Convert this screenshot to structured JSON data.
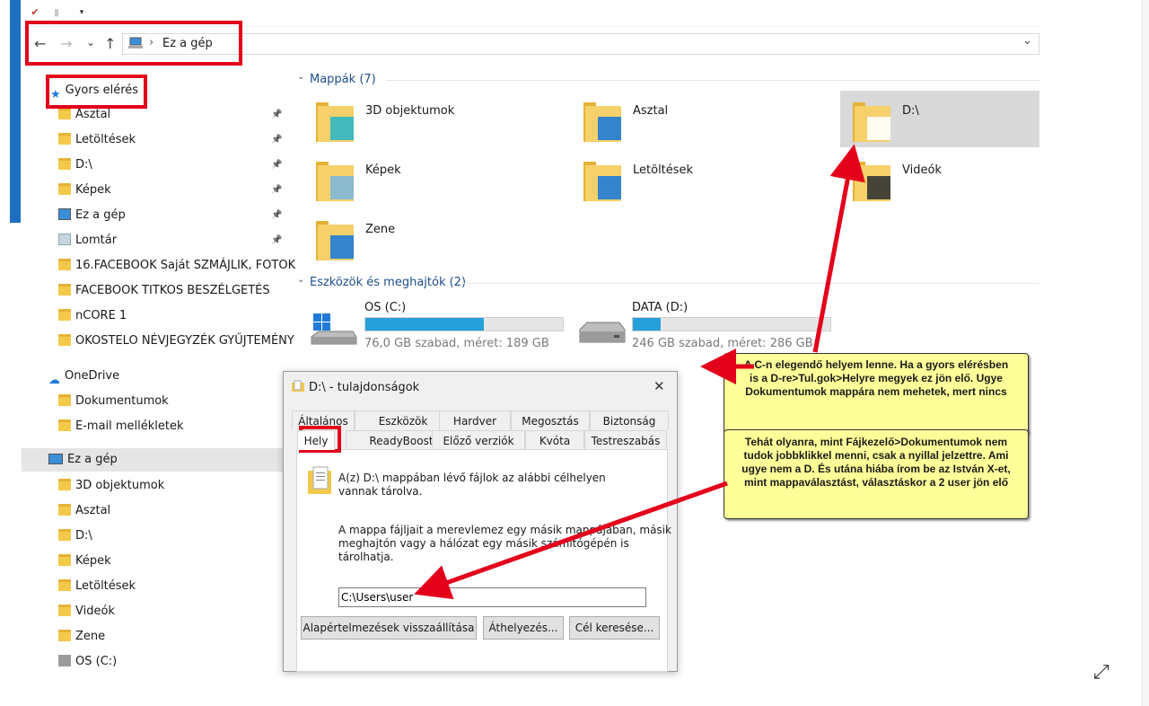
{
  "address": {
    "path_label": "Ez a gép",
    "separator": "›",
    "back": "←",
    "forward": "→",
    "recent": "⌄",
    "up": "↑",
    "dropdown": "⌄"
  },
  "sidebar": {
    "quick_access": "Gyors elérés",
    "quick_items": [
      {
        "label": "Asztal",
        "pinned": true
      },
      {
        "label": "Letöltések",
        "pinned": true
      },
      {
        "label": "D:\\",
        "pinned": true
      },
      {
        "label": "Képek",
        "pinned": true
      },
      {
        "label": "Ez a gép",
        "pinned": true
      },
      {
        "label": "Lomtár",
        "pinned": true
      },
      {
        "label": "16.FACEBOOK Saját SZMÁJLIK, FOTOK"
      },
      {
        "label": "FACEBOOK TITKOS BESZÉLGETÉS"
      },
      {
        "label": "nCORE 1"
      },
      {
        "label": "OKOSTELO NÉVJEGYZÉK GYŰJTEMÉNY"
      }
    ],
    "onedrive": "OneDrive",
    "onedrive_items": [
      "Dokumentumok",
      "E-mail mellékletek"
    ],
    "this_pc": "Ez a gép",
    "pc_items": [
      "3D objektumok",
      "Asztal",
      "D:\\",
      "Képek",
      "Letöltések",
      "Videók",
      "Zene",
      "OS (C:)"
    ]
  },
  "main": {
    "folders_header": "Mappák (7)",
    "folders": [
      "3D objektumok",
      "Asztal",
      "D:\\",
      "Képek",
      "Letöltések",
      "Videók",
      "Zene"
    ],
    "drives_header": "Eszközök és meghajtók (2)",
    "drives": [
      {
        "name": "OS (C:)",
        "free": "76,0 GB szabad, méret: 189 GB",
        "used_fraction": 0.6
      },
      {
        "name": "DATA (D:)",
        "free": "246 GB szabad, méret: 286 GB",
        "used_fraction": 0.14
      }
    ]
  },
  "dialog": {
    "title": "D:\\ - tulajdonságok",
    "close": "✕",
    "tabs_row1": [
      "Általános",
      "Eszközök",
      "Hardver",
      "Megosztás",
      "Biztonság"
    ],
    "tabs_row2": [
      "Hely",
      "ReadyBoost",
      "Előző verziók",
      "Kvóta",
      "Testreszabás"
    ],
    "description": "A(z) D:\\ mappában lévő fájlok az alábbi célhelyen vannak tárolva.",
    "description_line1": "A(z) D:\\ mappában lévő fájlok az alábbi célhelyen",
    "description_line2": "vannak tárolva.",
    "body_line1": "A mappa fájljait a merevlemez egy másik mappájában, másik",
    "body_line2": "meghajtón vagy a hálózat egy másik számítógépén is",
    "body_line3": "tárolhatja.",
    "path_value": "C:\\Users\\user",
    "btn_restore": "Alapértelmezések visszaállítása",
    "btn_move": "Áthelyezés...",
    "btn_find": "Cél keresése..."
  },
  "notes": {
    "note1_line1": "A C-n elegendő helyem lenne.  Ha a gyors elérésben",
    "note1_line2": "is a D-re>Tul.gok>Helyre megyek ez jön elő. Ugye",
    "note1_line3": "Dokumentumok mappára nem mehetek, mert nincs",
    "note2_line1": "Tehát olyanra, mint Fájkezelő>Dokumentumok nem",
    "note2_line2": "tudok jobbklikkel menni, csak a nyillal jelzettre. Ami",
    "note2_line3": "ugye nem a D. És utána hiába írom be  az István X-et,",
    "note2_line4": "mint mappaválasztást, választáskor  a  2 user jön elő"
  },
  "colors": {
    "annotation_red": "#e3001b",
    "note_yellow": "#ffff99",
    "accent_blue": "#26a0da",
    "section_blue": "#1e4e8c"
  }
}
